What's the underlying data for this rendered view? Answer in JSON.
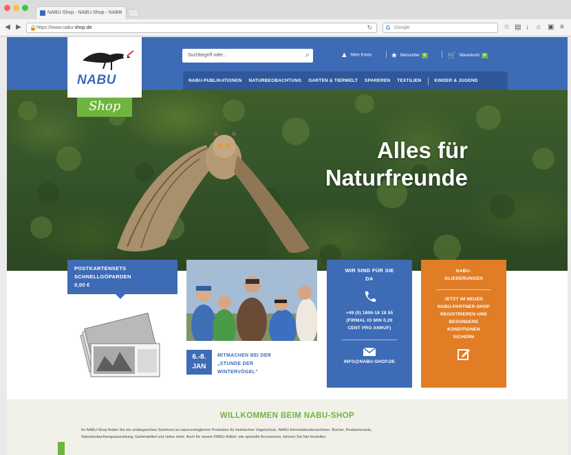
{
  "browser": {
    "tab_title": "NABU-Shop - NABU-Shop - NABU",
    "url_prefix": "https://www.nabu-",
    "url_domain": "shop.de",
    "search_engine_placeholder": "Google"
  },
  "header": {
    "logo_text": "NABU",
    "shop_label": "Shop",
    "search_placeholder": "Suchbegriff oder...",
    "account_label": "Mein Konto",
    "wishlist_label": "Merkzettel",
    "wishlist_count": "0",
    "cart_label": "Warenkorb",
    "cart_count": "0"
  },
  "nav": {
    "items": [
      "NABU-PUBLIKATIONEN",
      "NATURBEOBACHTUNG",
      "GARTEN & TIERWELT",
      "SPAREREN",
      "TEXTILIEN",
      "KINDER & JUGEND"
    ]
  },
  "hero": {
    "line1": "Alles für",
    "line2": "Naturfreunde"
  },
  "tiles": {
    "postcards_line1": "POSTKARTENSETS",
    "postcards_line2": "SCHNELLGÖPARDEN",
    "postcards_line3": "0,00 €",
    "event_date_line1": "6.-8.",
    "event_date_line2": "JAN",
    "event_line1": "MITMACHEN BEI DER",
    "event_line2": "„STUNDE DER",
    "event_line3": "WINTERVÖGEL“",
    "contact_title_line1": "WIR SIND FÜR SIE",
    "contact_title_line2": "DA",
    "contact_phone_line1": "+49 (0) 1806-18 18 55",
    "contact_phone_line2": "(FIRMAL IO MIN 0,20",
    "contact_phone_line3": "CENT PRO ANRUF)",
    "contact_email": "INFO@NABU-SHOP.DE",
    "member_title_line1": "NABU-",
    "member_title_line2": "GLIEDERUNGEN",
    "member_body_line1": "JETZT IM NEUEN",
    "member_body_line2": "NABU-PARTNER-SHOP",
    "member_body_line3": "REGISTRIEREN UND",
    "member_body_line4": "BESONDERE",
    "member_body_line5": "KONDITIONEN",
    "member_body_line6": "SICHERN"
  },
  "welcome": {
    "title": "WILLKOMMEN BEIM NABU-SHOP",
    "text_line1": "Im NABU-Shop finden Sie ein umfangreiches Sortiment an naturverträglichen Produkten für heimischen Vogelschutz, NABU-Informationsbroschüren, Bücher, Postkartensets,",
    "text_line2": "Naturbeobachtungsausrüstung, Gartenartikel und vieles mehr. Auch für unsere NABU-Artikel, wie spezielle Accessoires, können Sie hier bestellen."
  },
  "colors": {
    "nabu_blue": "#3d6bb5",
    "nabu_dark_blue": "#2f579a",
    "nabu_green": "#6fb43f",
    "nabu_orange": "#e07d25"
  }
}
